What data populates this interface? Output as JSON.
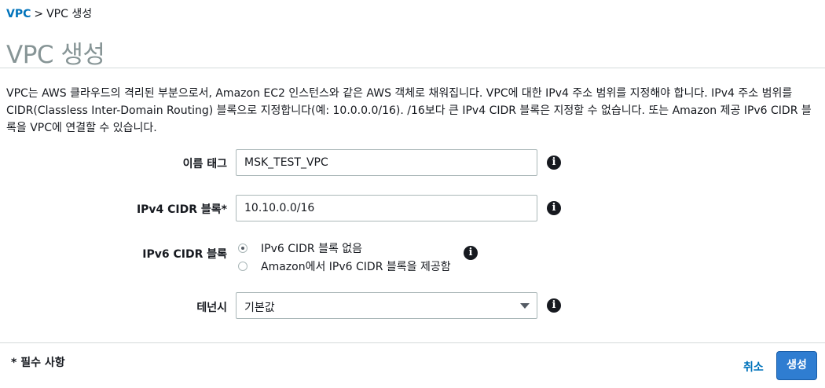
{
  "breadcrumb": {
    "root": "VPC",
    "separator": ">",
    "current": "VPC 생성"
  },
  "page_title": "VPC 생성",
  "description": "VPC는 AWS 클라우드의 격리된 부분으로서, Amazon EC2 인스턴스와 같은 AWS 객체로 채워집니다. VPC에 대한 IPv4 주소 범위를 지정해야 합니다. IPv4 주소 범위를 CIDR(Classless Inter-Domain Routing) 블록으로 지정합니다(예: 10.0.0.0/16). /16보다 큰 IPv4 CIDR 블록은 지정할 수 없습니다. 또는 Amazon 제공 IPv6 CIDR 블록을 VPC에 연결할 수 있습니다.",
  "form": {
    "name_tag": {
      "label": "이름 태그",
      "value": "MSK_TEST_VPC"
    },
    "ipv4_cidr": {
      "label": "IPv4 CIDR 블록*",
      "value": "10.10.0.0/16"
    },
    "ipv6_cidr": {
      "label": "IPv6 CIDR 블록",
      "options": [
        {
          "label": "IPv6 CIDR 블록 없음",
          "selected": true
        },
        {
          "label": "Amazon에서 IPv6 CIDR 블록을 제공함",
          "selected": false
        }
      ]
    },
    "tenancy": {
      "label": "테넌시",
      "value": "기본값"
    },
    "info_icon": "info-circle-icon"
  },
  "footer": {
    "required_note": "* 필수 사항",
    "cancel_label": "취소",
    "create_label": "생성"
  },
  "colors": {
    "link": "#0073bb",
    "primary_button": "#2f7dd1",
    "title": "#879596",
    "border": "#aab7b8"
  }
}
